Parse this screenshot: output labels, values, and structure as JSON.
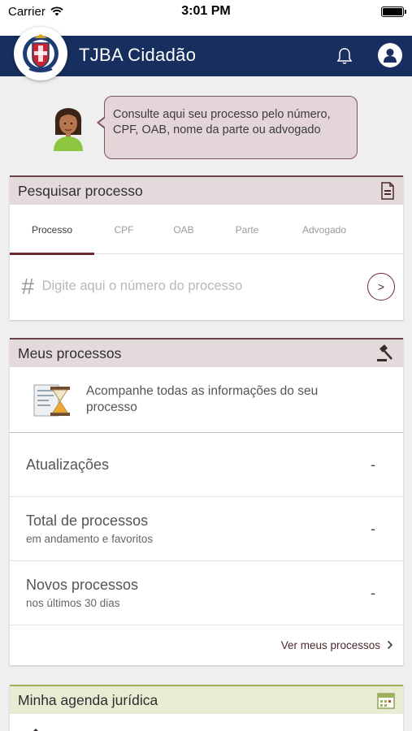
{
  "status_bar": {
    "carrier": "Carrier",
    "time": "3:01 PM",
    "battery_level": 1.0
  },
  "header": {
    "title": "TJBA Cidadão",
    "logo_text": "TJ",
    "brand_color": "#172f5e"
  },
  "intro": {
    "message": "Consulte aqui seu processo pelo número, CPF, OAB, nome da parte ou advogado"
  },
  "search_card": {
    "title": "Pesquisar processo",
    "tabs": [
      {
        "label": "Processo",
        "active": true
      },
      {
        "label": "CPF",
        "active": false
      },
      {
        "label": "OAB",
        "active": false
      },
      {
        "label": "Parte",
        "active": false
      },
      {
        "label": "Advogado",
        "active": false
      }
    ],
    "placeholder": "Digite aqui o número do processo"
  },
  "processes_card": {
    "title": "Meus processos",
    "info": "Acompanhe todas as informações do seu processo",
    "stats": [
      {
        "title": "Atualizações",
        "subtitle": "",
        "value": "-"
      },
      {
        "title": "Total de processos",
        "subtitle": "em andamento e favoritos",
        "value": "-"
      },
      {
        "title": "Novos processos",
        "subtitle": "nos últimos 30 dias",
        "value": "-"
      }
    ],
    "see_more": "Ver meus processos"
  },
  "agenda_card": {
    "title": "Minha agenda jurídica"
  }
}
